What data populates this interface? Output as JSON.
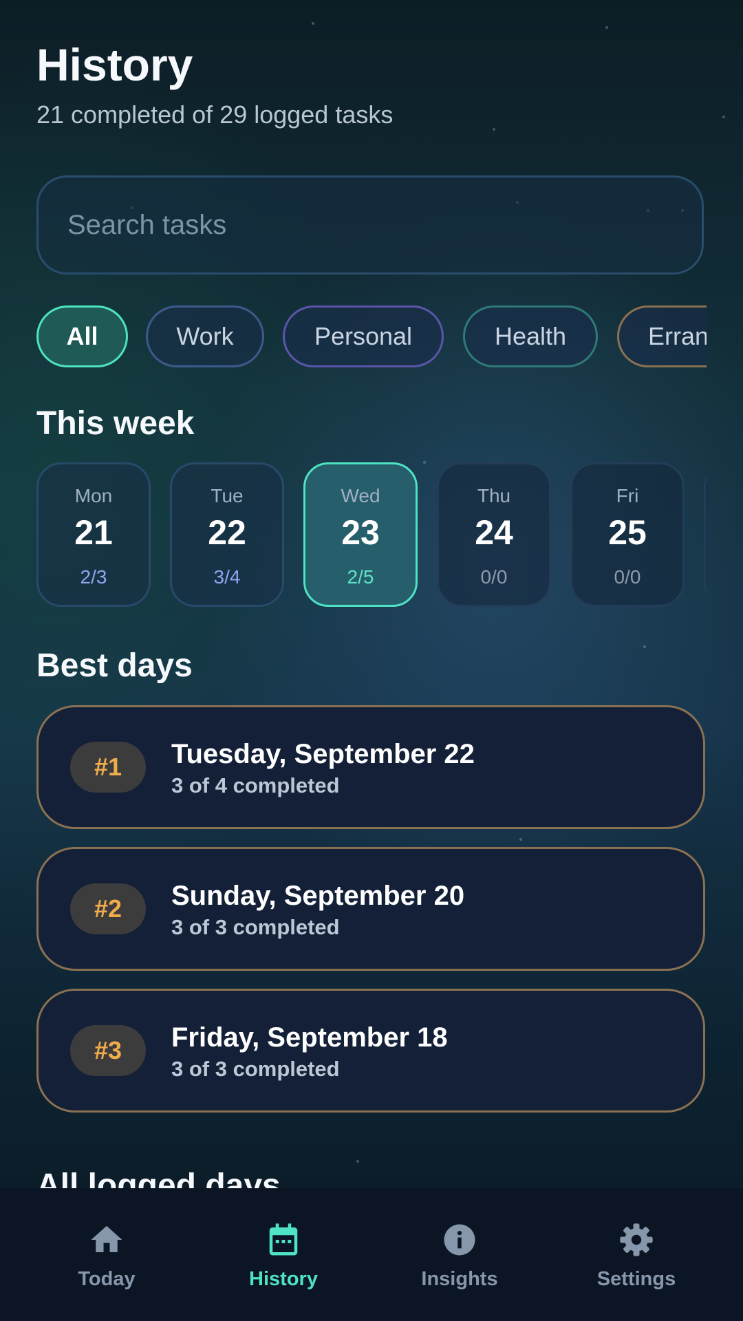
{
  "header": {
    "title": "History",
    "subtitle": "21 completed of 29 logged tasks"
  },
  "search": {
    "placeholder": "Search tasks",
    "value": ""
  },
  "filters": [
    {
      "label": "All",
      "active": true
    },
    {
      "label": "Work",
      "active": false
    },
    {
      "label": "Personal",
      "active": false
    },
    {
      "label": "Health",
      "active": false
    },
    {
      "label": "Errands",
      "active": false
    }
  ],
  "week": {
    "title": "This week",
    "days": [
      {
        "name": "Mon",
        "date": "21",
        "ratio": "2/3",
        "completed": 2,
        "total": 3
      },
      {
        "name": "Tue",
        "date": "22",
        "ratio": "3/4",
        "completed": 3,
        "total": 4
      },
      {
        "name": "Wed",
        "date": "23",
        "ratio": "2/5",
        "completed": 2,
        "total": 5,
        "selected": true
      },
      {
        "name": "Thu",
        "date": "24",
        "ratio": "0/0",
        "completed": 0,
        "total": 0
      },
      {
        "name": "Fri",
        "date": "25",
        "ratio": "0/0",
        "completed": 0,
        "total": 0
      }
    ]
  },
  "best_days": {
    "title": "Best days",
    "items": [
      {
        "rank": "#1",
        "date": "Tuesday, September 22",
        "summary": "3 of 4 completed"
      },
      {
        "rank": "#2",
        "date": "Sunday, September 20",
        "summary": "3 of 3 completed"
      },
      {
        "rank": "#3",
        "date": "Friday, September 18",
        "summary": "3 of 3 completed"
      }
    ]
  },
  "all_days": {
    "title": "All logged days"
  },
  "nav": {
    "items": [
      {
        "label": "Today",
        "icon": "home-icon",
        "active": false
      },
      {
        "label": "History",
        "icon": "calendar-icon",
        "active": true
      },
      {
        "label": "Insights",
        "icon": "info-icon",
        "active": false
      },
      {
        "label": "Settings",
        "icon": "gear-icon",
        "active": false
      }
    ]
  },
  "colors": {
    "accent": "#4ee3c2",
    "ratio": "#8fa6f0",
    "rank_badge_text": "#f0ac4b",
    "best_card_border": "#8a7152",
    "nav_inactive": "#8797ab"
  }
}
